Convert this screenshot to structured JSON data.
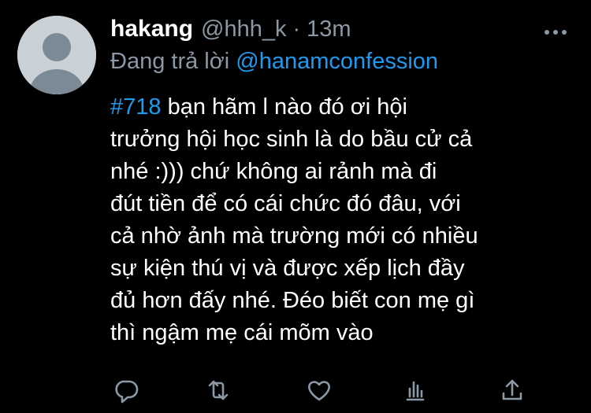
{
  "tweet": {
    "display_name": "hakang",
    "handle": "@hhh_k",
    "separator": "·",
    "time": "13m",
    "reply_prefix": "Đang trả lời",
    "reply_to": "@hanamconfession",
    "hashtag": "#718",
    "lines": [
      " bạn hãm l nào đó ơi hội",
      "trưởng hội học sinh là do bầu cử cả",
      "nhé :))) chứ không ai rảnh mà đi",
      "đút tiền để có cái chức đó đâu, với",
      "cả nhờ ảnh mà trường mới có nhiều",
      "sự kiện thú vị và được xếp lịch đầy",
      "đủ hơn đấy nhé. Đéo biết con mẹ gì",
      "thì ngậm mẹ cái mõm vào"
    ]
  },
  "icons": {
    "more": "more-horizontal-icon",
    "reply": "reply-icon",
    "retweet": "retweet-icon",
    "like": "heart-icon",
    "analytics": "analytics-icon",
    "share": "share-icon"
  },
  "colors": {
    "background": "#000000",
    "text": "#ffffff",
    "secondary": "#8b98a5",
    "accent": "#1d9bf0"
  }
}
